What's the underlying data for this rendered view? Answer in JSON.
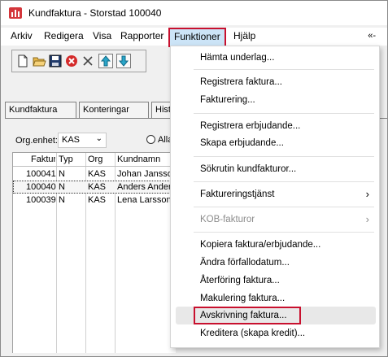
{
  "window": {
    "title": "Kundfaktura - Storstad 100040"
  },
  "menubar": {
    "items": [
      "Arkiv",
      "Redigera",
      "Visa",
      "Rapporter",
      "Funktioner",
      "Hjälp"
    ],
    "right": "«-",
    "active_item": "Funktioner"
  },
  "toolbar": {
    "icons": [
      "new-icon",
      "open-icon",
      "save-icon",
      "cancel-icon",
      "delete-icon",
      "arrow-up-icon",
      "arrow-down-icon"
    ]
  },
  "tabs": [
    "Kundfaktura",
    "Konteringar",
    "Hist"
  ],
  "filter": {
    "org_label": "Org.enhet:",
    "org_value": "KAS",
    "radio_label": "Alla"
  },
  "grid": {
    "columns": [
      "Fakturanr",
      "Typ",
      "Org",
      "Kundnamn"
    ],
    "rows": [
      [
        "100041",
        "N",
        "KAS",
        "Johan Jansson"
      ],
      [
        "100040",
        "N",
        "KAS",
        "Anders Andersson"
      ],
      [
        "100039",
        "N",
        "KAS",
        "Lena Larsson"
      ]
    ],
    "selected_row": 1
  },
  "dropdown": {
    "items": [
      {
        "label": "Hämta underlag...",
        "disabled": false
      },
      {
        "label": "Registrera faktura...",
        "disabled": false
      },
      {
        "label": "Fakturering...",
        "disabled": false
      },
      {
        "label": "Registrera erbjudande...",
        "disabled": false
      },
      {
        "label": "Skapa erbjudande...",
        "disabled": false
      },
      {
        "label": "Sökrutin kundfakturor...",
        "disabled": false
      },
      {
        "label": "Faktureringstjänst",
        "disabled": false,
        "submenu": true
      },
      {
        "label": "KOB-fakturor",
        "disabled": true,
        "submenu": true
      },
      {
        "label": "Kopiera faktura/erbjudande...",
        "disabled": false
      },
      {
        "label": "Ändra förfallodatum...",
        "disabled": false
      },
      {
        "label": "Återföring faktura...",
        "disabled": false
      },
      {
        "label": "Makulering faktura...",
        "disabled": false
      },
      {
        "label": "Avskrivning faktura...",
        "disabled": false,
        "highlighted": true
      },
      {
        "label": "Kreditera (skapa kredit)...",
        "disabled": false
      }
    ],
    "submenu_arrow": "›"
  },
  "colors": {
    "highlight": "#c8102e",
    "menu_active_bg": "#cce4f7"
  }
}
